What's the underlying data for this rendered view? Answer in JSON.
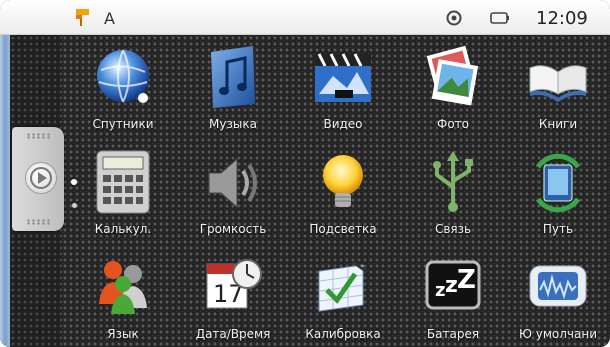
{
  "statusbar": {
    "letter": "A",
    "time": "12:09",
    "icons": [
      "flag-icon",
      "gps-icon",
      "battery-icon"
    ]
  },
  "sidebar": {
    "handle_icon": "play-icon"
  },
  "menu": {
    "items": [
      {
        "label": "Спутники",
        "icon": "globe-icon"
      },
      {
        "label": "Музыка",
        "icon": "music-note-icon"
      },
      {
        "label": "Видео",
        "icon": "video-clapper-icon"
      },
      {
        "label": "Фото",
        "icon": "photos-icon"
      },
      {
        "label": "Книги",
        "icon": "book-icon"
      },
      {
        "label": "Калькул.",
        "icon": "calculator-icon"
      },
      {
        "label": "Громкость",
        "icon": "speaker-icon"
      },
      {
        "label": "Подсветка",
        "icon": "light-bulb-icon"
      },
      {
        "label": "Связь",
        "icon": "usb-icon"
      },
      {
        "label": "Путь",
        "icon": "navigator-refresh-icon"
      },
      {
        "label": "Язык",
        "icon": "people-icon"
      },
      {
        "label": "Дата/Время",
        "icon": "calendar-clock-icon"
      },
      {
        "label": "Калибровка",
        "icon": "calibration-check-icon"
      },
      {
        "label": "Батарея",
        "icon": "sleep-zzz-icon"
      },
      {
        "label": "Ю умолчани",
        "icon": "device-default-icon"
      }
    ]
  }
}
